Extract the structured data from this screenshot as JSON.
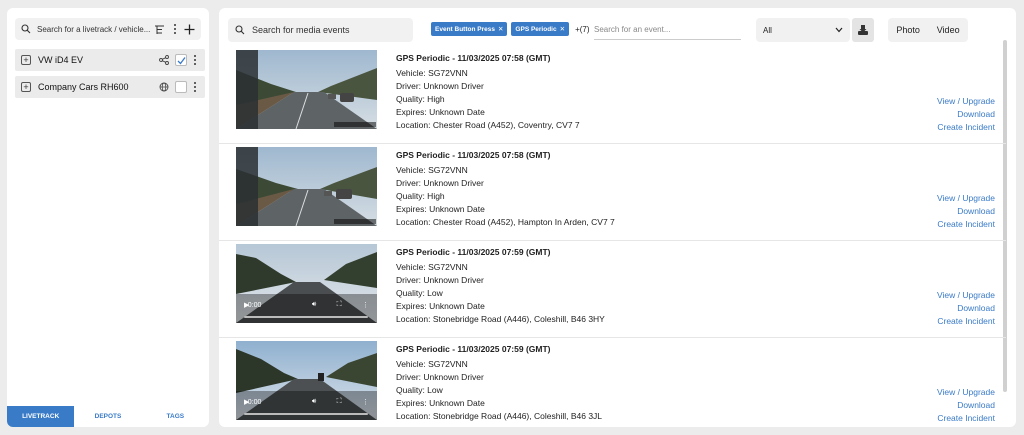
{
  "sidebar": {
    "search_placeholder": "Search for a livetrack / vehicle...",
    "vehicles": [
      {
        "name": "VW iD4 EV"
      },
      {
        "name": "Company Cars RH600"
      }
    ],
    "tabs": [
      {
        "label": "LIVETRACK",
        "active": true
      },
      {
        "label": "DEPOTS",
        "active": false
      },
      {
        "label": "TAGS",
        "active": false
      }
    ]
  },
  "toolbar": {
    "search_placeholder": "Search for media events",
    "filter_tags": [
      "Event Button Press",
      "GPS Periodic"
    ],
    "more_tags": "+(7)",
    "event_search_placeholder": "Search for an event...",
    "select_value": "All",
    "media_types": [
      "Photo",
      "Video"
    ]
  },
  "events": [
    {
      "title": "GPS Periodic - 11/03/2025 07:58 (GMT)",
      "vehicle": "Vehicle: SG72VNN",
      "driver": "Driver: Unknown Driver",
      "quality": "Quality: High",
      "expires": "Expires: Unknown Date",
      "location": "Location: Chester Road (A452), Coventry, CV7 7",
      "media": "photo"
    },
    {
      "title": "GPS Periodic - 11/03/2025 07:58 (GMT)",
      "vehicle": "Vehicle: SG72VNN",
      "driver": "Driver: Unknown Driver",
      "quality": "Quality: High",
      "expires": "Expires: Unknown Date",
      "location": "Location: Chester Road (A452), Hampton In Arden, CV7 7",
      "media": "photo"
    },
    {
      "title": "GPS Periodic - 11/03/2025 07:59 (GMT)",
      "vehicle": "Vehicle: SG72VNN",
      "driver": "Driver: Unknown Driver",
      "quality": "Quality: Low",
      "expires": "Expires: Unknown Date",
      "location": "Location: Stonebridge Road (A446), Coleshill, B46 3HY",
      "media": "video",
      "video_time": "0:00"
    },
    {
      "title": "GPS Periodic - 11/03/2025 07:59 (GMT)",
      "vehicle": "Vehicle: SG72VNN",
      "driver": "Driver: Unknown Driver",
      "quality": "Quality: Low",
      "expires": "Expires: Unknown Date",
      "location": "Location: Stonebridge Road (A446), Coleshill, B46 3JL",
      "media": "video",
      "video_time": "0:00"
    }
  ],
  "actions": {
    "view": "View / Upgrade",
    "download": "Download",
    "incident": "Create Incident"
  },
  "colors": {
    "accent": "#3a7bc8"
  }
}
